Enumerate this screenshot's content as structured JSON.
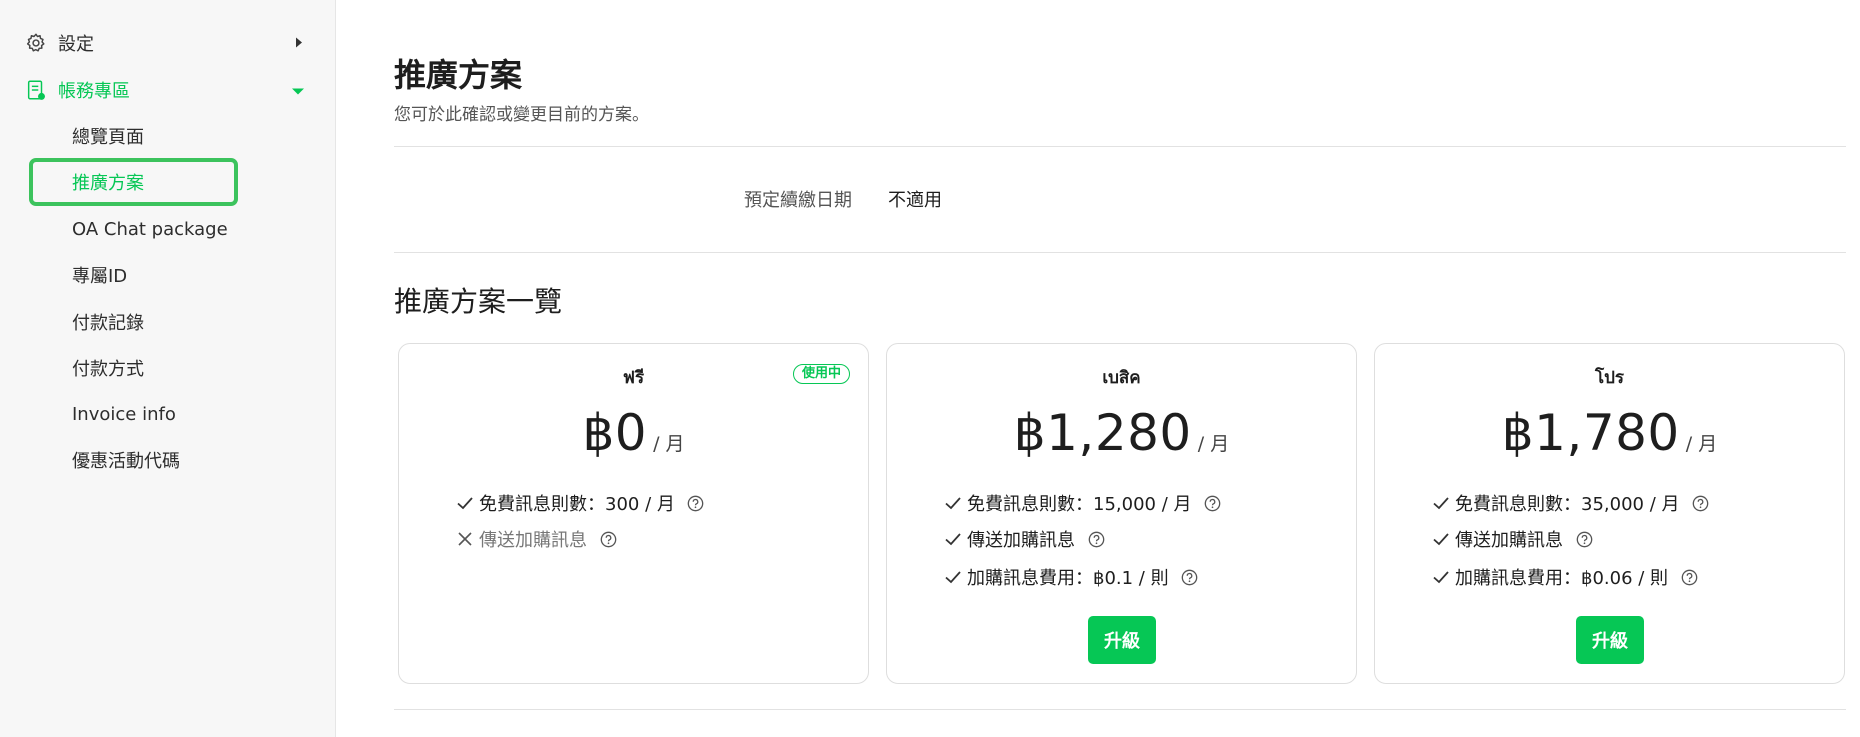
{
  "sidebar": {
    "settings": {
      "label": "設定",
      "icon": "gear-icon"
    },
    "billing": {
      "label": "帳務專區",
      "icon": "document-icon"
    },
    "items": [
      {
        "label": "總覽頁面",
        "active": false
      },
      {
        "label": "推廣方案",
        "active": true
      },
      {
        "label": "OA Chat package",
        "active": false
      },
      {
        "label": "專屬ID",
        "active": false
      },
      {
        "label": "付款記錄",
        "active": false
      },
      {
        "label": "付款方式",
        "active": false
      },
      {
        "label": "Invoice info",
        "active": false
      },
      {
        "label": "優惠活動代碼",
        "active": false
      }
    ]
  },
  "main": {
    "title": "推廣方案",
    "subtitle": "您可於此確認或變更目前的方案。",
    "renewal": {
      "label": "預定續繳日期",
      "value": "不適用"
    },
    "plans_title": "推廣方案一覽",
    "plans": [
      {
        "name": "ฟรี",
        "badge": "使用中",
        "price": "฿0",
        "unit": "/ 月",
        "features": [
          {
            "text": "免費訊息則數：300 / 月",
            "included": true
          },
          {
            "text": "傳送加購訊息",
            "included": false
          }
        ]
      },
      {
        "name": "เบสิค",
        "price": "฿1,280",
        "unit": "/ 月",
        "features": [
          {
            "text": "免費訊息則數：15,000 / 月",
            "included": true
          },
          {
            "text": "傳送加購訊息",
            "included": true
          },
          {
            "text": "加購訊息費用：฿0.1 / 則",
            "included": true
          }
        ],
        "button": "升級"
      },
      {
        "name": "โปร",
        "price": "฿1,780",
        "unit": "/ 月",
        "features": [
          {
            "text": "免費訊息則數：35,000 / 月",
            "included": true
          },
          {
            "text": "傳送加購訊息",
            "included": true
          },
          {
            "text": "加購訊息費用：฿0.06 / 則",
            "included": true
          }
        ],
        "button": "升級"
      }
    ]
  },
  "colors": {
    "accent": "#06c755",
    "highlight": "#3cc35d"
  }
}
